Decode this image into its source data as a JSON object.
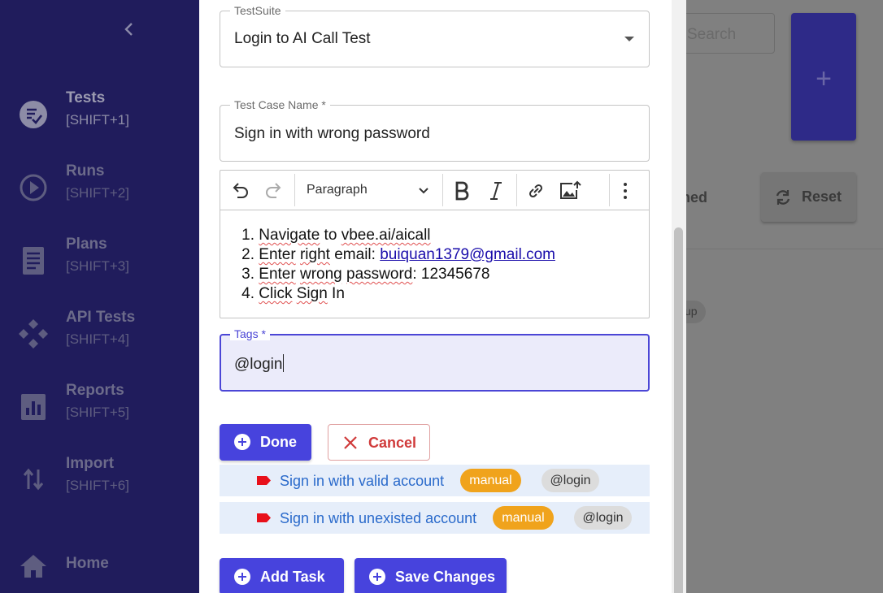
{
  "sidebar": {
    "items": [
      {
        "label": "Tests",
        "shortcut": "[SHIFT+1]",
        "icon": "tests-check-icon"
      },
      {
        "label": "Runs",
        "shortcut": "[SHIFT+2]",
        "icon": "play-circle-icon"
      },
      {
        "label": "Plans",
        "shortcut": "[SHIFT+3]",
        "icon": "clipboard-icon"
      },
      {
        "label": "API Tests",
        "shortcut": "[SHIFT+4]",
        "icon": "api-diamond-icon"
      },
      {
        "label": "Reports",
        "shortcut": "[SHIFT+5]",
        "icon": "bar-chart-icon"
      },
      {
        "label": "Import",
        "shortcut": "[SHIFT+6]",
        "icon": "swap-vertical-icon"
      },
      {
        "label": "Home",
        "shortcut": "",
        "icon": "home-icon"
      }
    ]
  },
  "background": {
    "search_placeholder": "Search",
    "add_label": "+",
    "matched_text": "ched",
    "reset_label": "Reset",
    "chip_text": "up"
  },
  "form": {
    "suite": {
      "label": "TestSuite",
      "value": "Login to AI Call Test"
    },
    "name": {
      "label": "Test Case Name *",
      "value": "Sign in with wrong password"
    },
    "editor": {
      "block_type": "Paragraph",
      "steps": [
        {
          "num": "1.",
          "text": "Navigate to vbee.ai/aicall"
        },
        {
          "num": "2.",
          "prefix": "Enter right email: ",
          "link": "buiquan1379@gmail.com"
        },
        {
          "num": "3.",
          "text": "Enter wrong password: 12345678"
        },
        {
          "num": "4.",
          "text": "Click Sign In"
        }
      ]
    },
    "tags": {
      "label": "Tags *",
      "value": "@login"
    },
    "done_label": "Done",
    "cancel_label": "Cancel"
  },
  "tasks": [
    {
      "name": "Sign in with valid account",
      "type": "manual",
      "tag": "@login"
    },
    {
      "name": "Sign in with unexisted account",
      "type": "manual",
      "tag": "@login"
    }
  ],
  "actions": {
    "add_task_label": "Add Task",
    "save_label": "Save Changes"
  },
  "colors": {
    "primary": "#4743dd",
    "sidebar": "#201c5c",
    "manual_chip": "#f0a31c",
    "cancel": "#d03a3a",
    "task_link": "#2a6acb"
  }
}
